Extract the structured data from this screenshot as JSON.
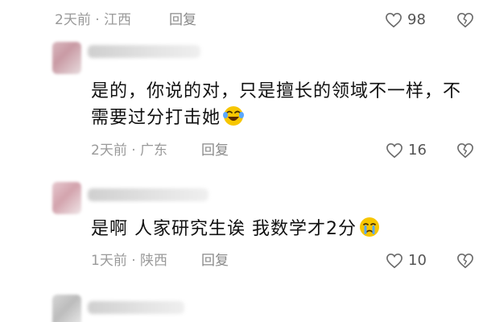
{
  "comments": [
    {
      "meta": "2天前 · 江西",
      "reply_label": "回复",
      "likes": "98",
      "icons": {
        "like": "heart-outline-icon",
        "dislike": "broken-heart-icon"
      }
    },
    {
      "author": "Hsss  Yang",
      "text": "是的，你说的对，只是擅长的领域不一样，不需要过分打击她",
      "emoji": "laughing-crying-face",
      "meta": "2天前 · 广东",
      "reply_label": "回复",
      "likes": "16"
    },
    {
      "text": "是啊 人家研究生诶 我数学才2分",
      "emoji": "crying-face",
      "meta": "1天前 · 陕西",
      "reply_label": "回复",
      "likes": "10"
    }
  ],
  "colors": {
    "meta_gray": "#9a9a9a",
    "text": "#111111",
    "emoji_yellow": "#f7c600",
    "tear_blue": "#5aa7ff"
  }
}
